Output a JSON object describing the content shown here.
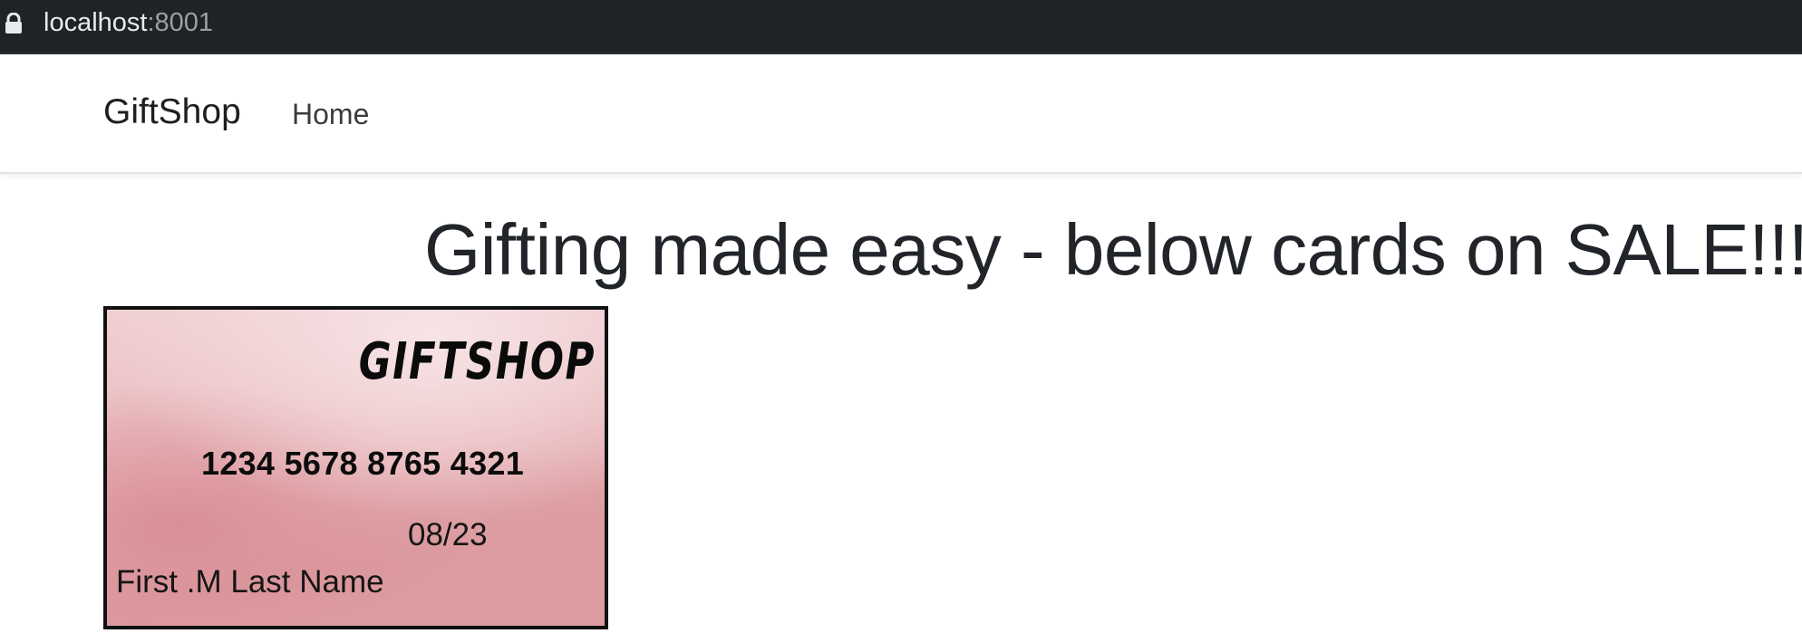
{
  "browser": {
    "url_host": "localhost",
    "url_port": ":8001",
    "lock_icon": "lock-icon"
  },
  "navbar": {
    "brand": "GiftShop",
    "links": [
      "Home"
    ]
  },
  "main": {
    "headline": "Gifting made easy - below cards on SALE!!!",
    "cards": [
      {
        "logo": "GIFTSHOP",
        "number": "1234 5678 8765 4321",
        "expiry": "08/23",
        "holder": "First .M Last Name"
      }
    ]
  },
  "colors": {
    "browser_bar": "#2b2f33",
    "text_dark": "#212529",
    "card_pink": "#e8b7bb",
    "card_border": "#111111"
  }
}
